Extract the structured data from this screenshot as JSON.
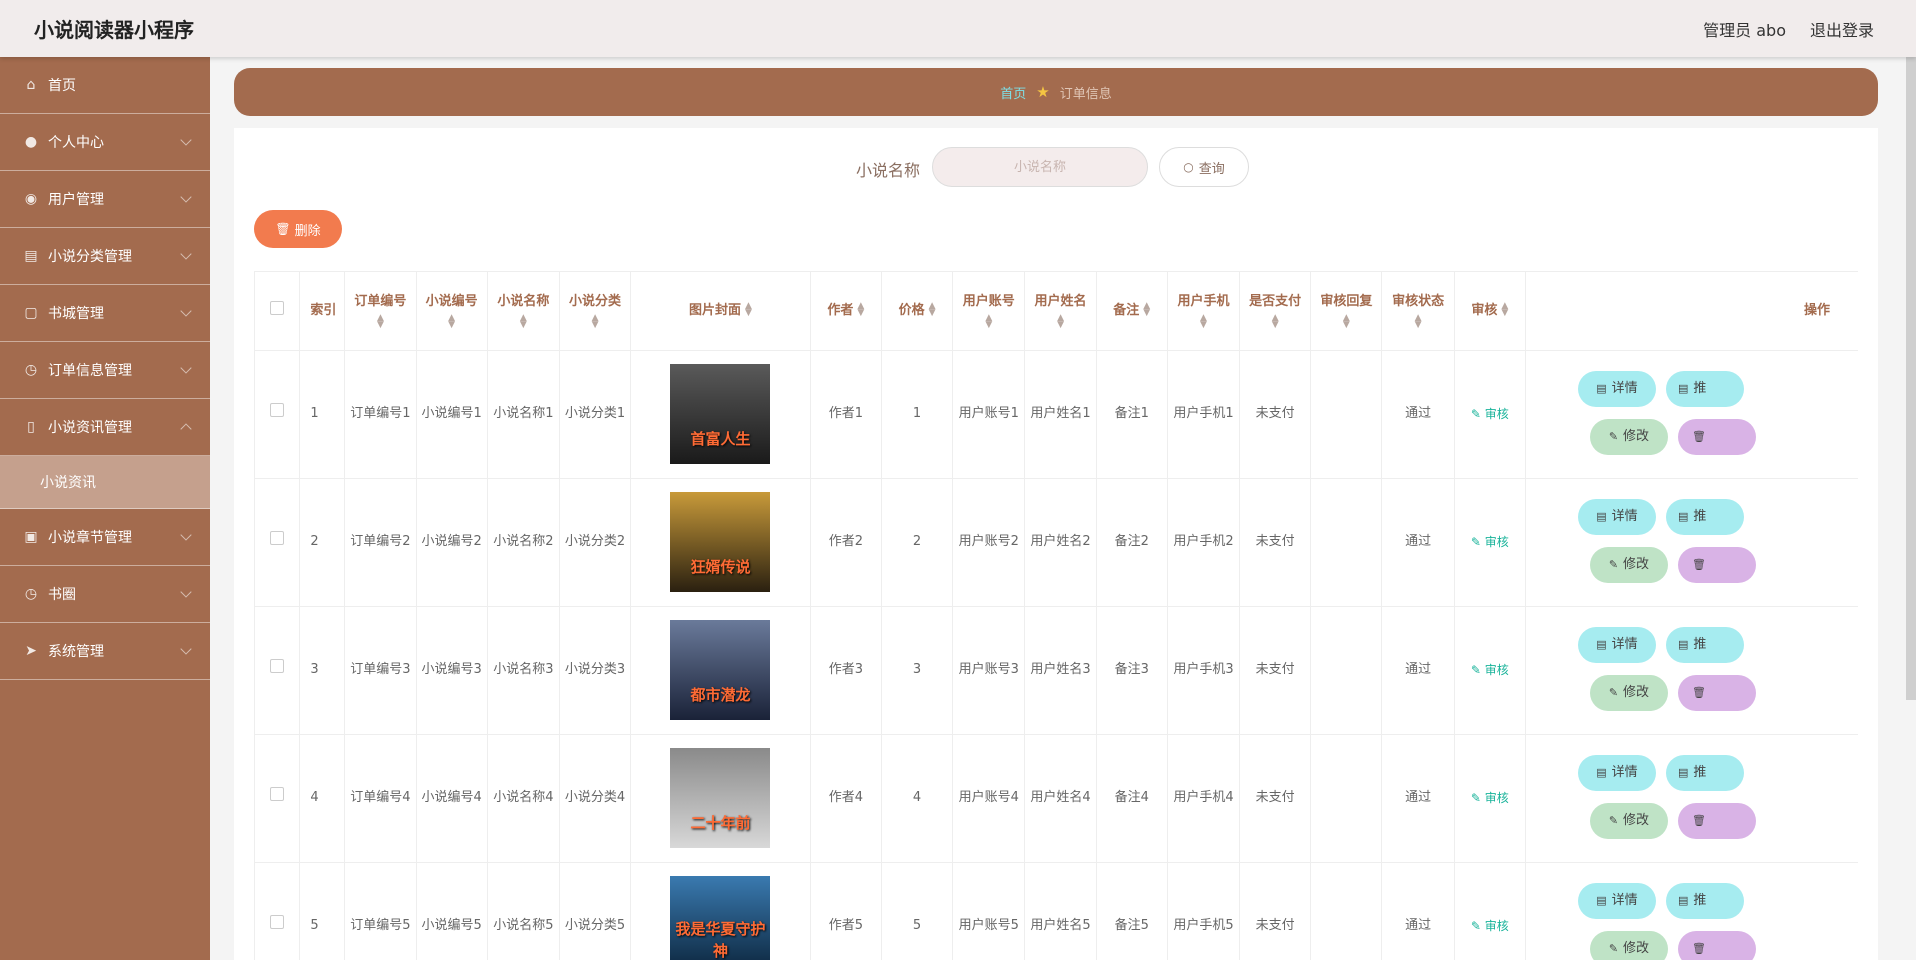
{
  "app": {
    "title": "小说阅读器小程序",
    "admin": "管理员 abo",
    "logout": "退出登录"
  },
  "sidebar": {
    "items": [
      {
        "label": "首页",
        "icon": "home-icon",
        "chevron": false
      },
      {
        "label": "个人中心",
        "icon": "user-icon",
        "chevron": true
      },
      {
        "label": "用户管理",
        "icon": "location-icon",
        "chevron": true
      },
      {
        "label": "小说分类管理",
        "icon": "folder-icon",
        "chevron": true
      },
      {
        "label": "书城管理",
        "icon": "copy-icon",
        "chevron": true
      },
      {
        "label": "订单信息管理",
        "icon": "clock-icon",
        "chevron": true
      },
      {
        "label": "小说资讯管理",
        "icon": "phone-icon",
        "chevron": true,
        "expanded": true
      },
      {
        "label": "小说章节管理",
        "icon": "clipboard-icon",
        "chevron": true
      },
      {
        "label": "书圈",
        "icon": "clock-icon",
        "chevron": true
      },
      {
        "label": "系统管理",
        "icon": "send-icon",
        "chevron": true
      }
    ],
    "sub_item": "小说资讯"
  },
  "breadcrumb": {
    "home": "首页",
    "current": "订单信息"
  },
  "search": {
    "label": "小说名称",
    "placeholder": "小说名称",
    "button": "查询"
  },
  "delete_button": "删除",
  "table": {
    "headers": [
      "索引",
      "订单编号",
      "小说编号",
      "小说名称",
      "小说分类",
      "图片封面",
      "作者",
      "价格",
      "用户账号",
      "用户姓名",
      "备注",
      "用户手机",
      "是否支付",
      "审核回复",
      "审核状态",
      "审核",
      "操作"
    ],
    "rows": [
      {
        "index": "1",
        "order_no": "订单编号1",
        "novel_no": "小说编号1",
        "novel_name": "小说名称1",
        "category": "小说分类1",
        "cover_title": "首富人生",
        "author": "作者1",
        "price": "1",
        "account": "用户账号1",
        "username": "用户姓名1",
        "note": "备注1",
        "phone": "用户手机1",
        "paid": "未支付",
        "reply": "",
        "status": "通过",
        "audit": "审核"
      },
      {
        "index": "2",
        "order_no": "订单编号2",
        "novel_no": "小说编号2",
        "novel_name": "小说名称2",
        "category": "小说分类2",
        "cover_title": "狂婿传说",
        "author": "作者2",
        "price": "2",
        "account": "用户账号2",
        "username": "用户姓名2",
        "note": "备注2",
        "phone": "用户手机2",
        "paid": "未支付",
        "reply": "",
        "status": "通过",
        "audit": "审核"
      },
      {
        "index": "3",
        "order_no": "订单编号3",
        "novel_no": "小说编号3",
        "novel_name": "小说名称3",
        "category": "小说分类3",
        "cover_title": "都市潜龙",
        "author": "作者3",
        "price": "3",
        "account": "用户账号3",
        "username": "用户姓名3",
        "note": "备注3",
        "phone": "用户手机3",
        "paid": "未支付",
        "reply": "",
        "status": "通过",
        "audit": "审核"
      },
      {
        "index": "4",
        "order_no": "订单编号4",
        "novel_no": "小说编号4",
        "novel_name": "小说名称4",
        "category": "小说分类4",
        "cover_title": "二十年前",
        "author": "作者4",
        "price": "4",
        "account": "用户账号4",
        "username": "用户姓名4",
        "note": "备注4",
        "phone": "用户手机4",
        "paid": "未支付",
        "reply": "",
        "status": "通过",
        "audit": "审核"
      },
      {
        "index": "5",
        "order_no": "订单编号5",
        "novel_no": "小说编号5",
        "novel_name": "小说名称5",
        "category": "小说分类5",
        "cover_title": "我是华夏守护神",
        "author": "作者5",
        "price": "5",
        "account": "用户账号5",
        "username": "用户姓名5",
        "note": "备注5",
        "phone": "用户手机5",
        "paid": "未支付",
        "reply": "",
        "status": "通过",
        "audit": "审核"
      }
    ],
    "ops": {
      "detail": "详情",
      "push": "推",
      "edit": "修改",
      "del": "删"
    }
  },
  "colors": {
    "sidebar": "#a36b4e",
    "accent": "#f27b4e",
    "teal": "#a6ecf0",
    "green": "#bfe3c6",
    "purple": "#d9b3e6"
  }
}
